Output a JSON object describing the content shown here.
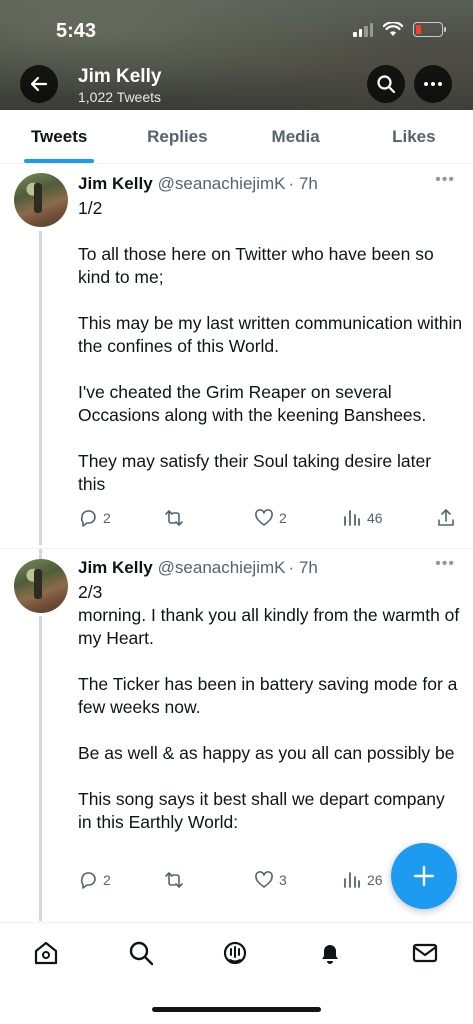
{
  "status_bar": {
    "time": "5:43"
  },
  "profile": {
    "name": "Jim Kelly",
    "tweet_count": "1,022 Tweets"
  },
  "tabs": [
    {
      "label": "Tweets",
      "active": true
    },
    {
      "label": "Replies",
      "active": false
    },
    {
      "label": "Media",
      "active": false
    },
    {
      "label": "Likes",
      "active": false
    }
  ],
  "tweets": [
    {
      "name": "Jim Kelly",
      "handle": "@seanachiejimK",
      "time": "· 7h",
      "text": "1/2\n\nTo all those here on Twitter who have been so kind to me;\n\nThis may be my last written communication within the confines of this World.\n\nI've cheated the Grim Reaper on several Occasions along with the keening Banshees.\n\nThey may satisfy their Soul taking desire later this",
      "replies": "2",
      "retweets": "",
      "likes": "2",
      "views": "46"
    },
    {
      "name": "Jim Kelly",
      "handle": "@seanachiejimK",
      "time": "· 7h",
      "text": "2/3\nmorning. I thank you all kindly from the warmth of my Heart.\n\nThe Ticker has been in battery saving mode for a few weeks now.\n\nBe as well & as happy as you all can possibly be\n\nThis song says it best shall we depart company in this Earthly World:",
      "replies": "2",
      "retweets": "",
      "likes": "3",
      "views": "26"
    }
  ],
  "colors": {
    "accent": "#1d9bf0",
    "battery_low": "#ff3b30"
  },
  "icons": [
    "back-arrow-icon",
    "search-icon",
    "more-icon",
    "reply-icon",
    "retweet-icon",
    "like-icon",
    "views-icon",
    "share-icon",
    "compose-icon",
    "home-icon",
    "explore-icon",
    "spaces-icon",
    "notifications-icon",
    "messages-icon"
  ]
}
